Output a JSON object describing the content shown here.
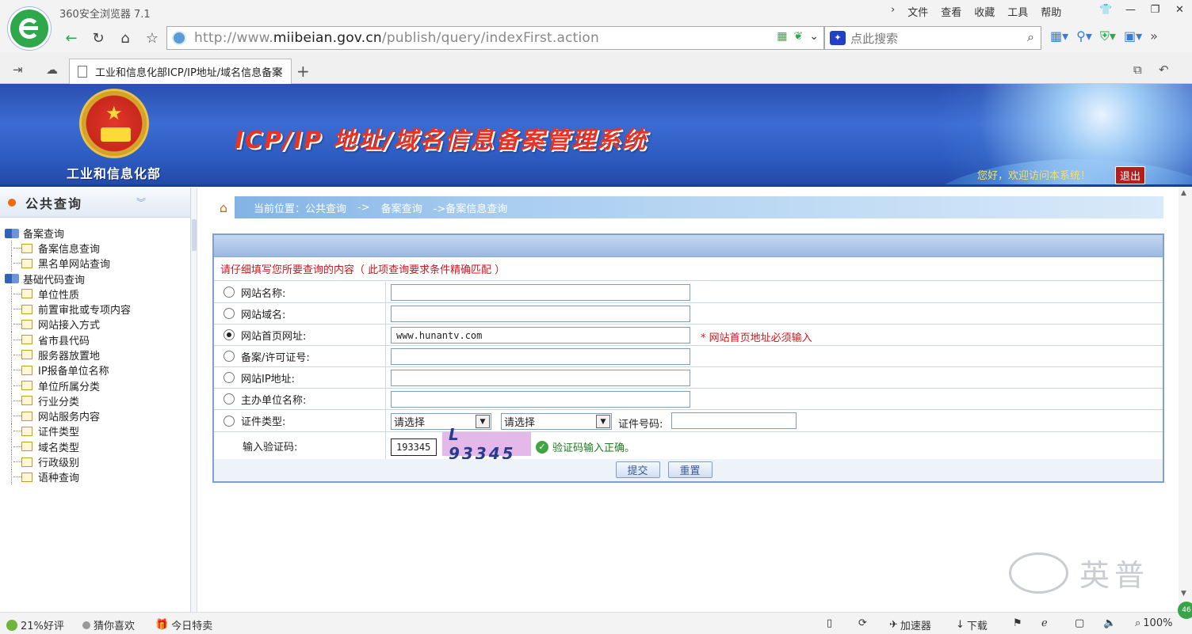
{
  "browser": {
    "title": "360安全浏览器 7.1",
    "menu": [
      "文件",
      "查看",
      "收藏",
      "工具",
      "帮助"
    ],
    "url_host": "http://www.",
    "url_domain": "miibeian.gov.cn",
    "url_path": "/publish/query/indexFirst.action",
    "search_placeholder": "点此搜索",
    "tab_title": "工业和信息化部ICP/IP地址/域名信息备案",
    "close_glyph": "×",
    "newtab_glyph": "+"
  },
  "banner": {
    "ministry": "工业和信息化部",
    "system_title": "ICP/IP 地址/域名信息备案管理系统",
    "welcome": "您好，欢迎访问本系统！",
    "logout": "退出"
  },
  "sidebar": {
    "title": "公共查询",
    "group1": "备案查询",
    "group1_items": [
      "备案信息查询",
      "黑名单网站查询"
    ],
    "group2": "基础代码查询",
    "group2_items": [
      "单位性质",
      "前置审批或专项内容",
      "网站接入方式",
      "省市县代码",
      "服务器放置地",
      "IP报备单位名称",
      "单位所属分类",
      "行业分类",
      "网站服务内容",
      "证件类型",
      "域名类型",
      "行政级别",
      "语种查询"
    ]
  },
  "breadcrumb": {
    "prefix": "当前位置：公共查询",
    "sep1": "->",
    "level2": "备案查询",
    "level3": "->备案信息查询"
  },
  "form": {
    "notice": "请仔细填写您所要查询的内容（ 此项查询要求条件精确匹配 ）",
    "labels": [
      "网站名称:",
      "网站域名:",
      "网站首页网址:",
      "备案/许可证号:",
      "网站IP地址:",
      "主办单位名称:",
      "证件类型:"
    ],
    "homepage_value": "www.hunantv.com",
    "homepage_required": "* 网站首页地址必须输入",
    "select1": "请选择",
    "select2": "请选择",
    "id_number_label": "证件号码:",
    "captcha_label": "输入验证码:",
    "captcha_value": "193345",
    "captcha_image_text": "L 93345",
    "captcha_ok": "验证码输入正确。",
    "submit": "提交",
    "reset": "重置",
    "selected_option": "网站首页网址:"
  },
  "watermark": "英普",
  "statusbar": {
    "rating": "21%好评",
    "guess": "猜你喜欢",
    "deal": "今日特卖",
    "accelerator": "加速器",
    "download": "下载",
    "zoom": "100%",
    "badge": "46"
  }
}
